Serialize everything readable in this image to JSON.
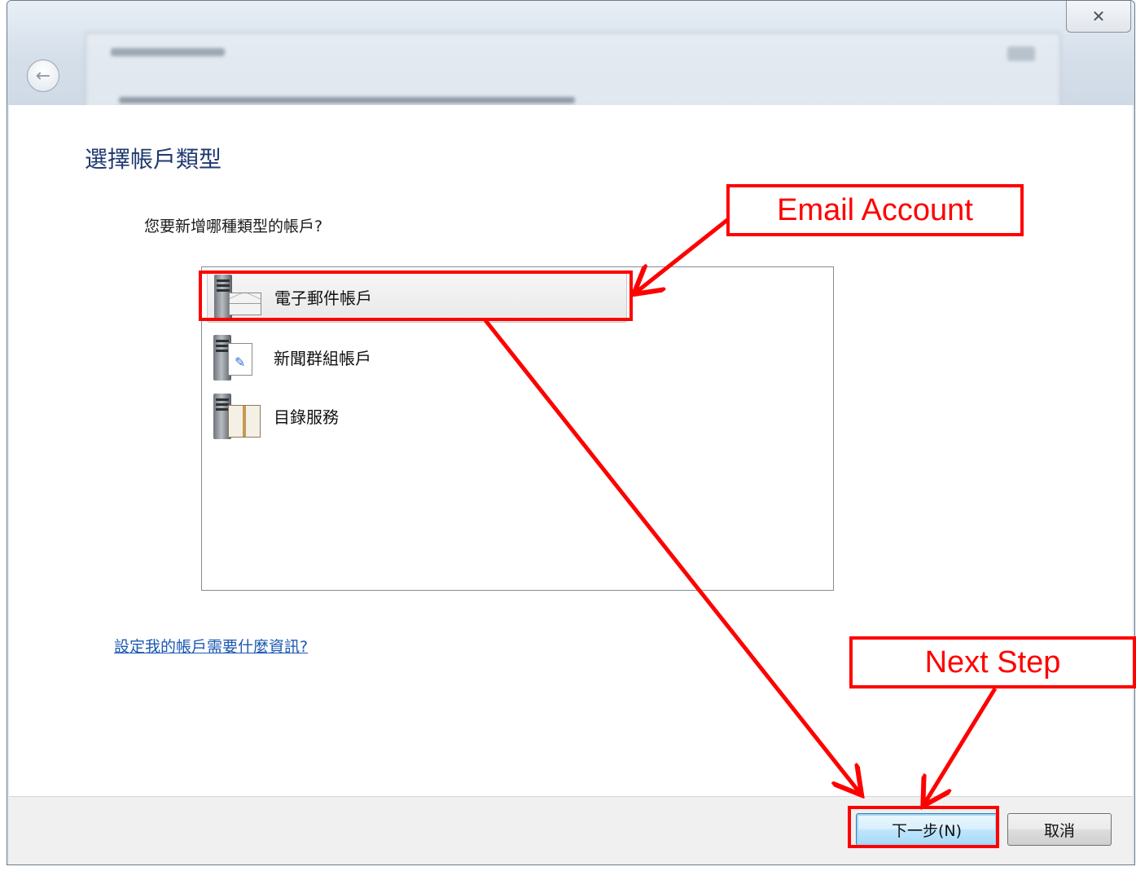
{
  "window": {
    "close_glyph": "✕",
    "back_glyph": "←"
  },
  "page": {
    "title": "選擇帳戶類型",
    "question": "您要新增哪種類型的帳戶?"
  },
  "account_types": [
    {
      "label": "電子郵件帳戶",
      "icon": "email-server-icon",
      "selected": true
    },
    {
      "label": "新聞群組帳戶",
      "icon": "newsgroup-server-icon",
      "selected": false
    },
    {
      "label": "目錄服務",
      "icon": "directory-server-icon",
      "selected": false
    }
  ],
  "help_link": "設定我的帳戶需要什麼資訊?",
  "buttons": {
    "next": "下一步(N)",
    "cancel": "取消"
  },
  "annotations": {
    "email_callout": "Email Account",
    "next_callout": "Next Step",
    "color": "#ff0000"
  }
}
